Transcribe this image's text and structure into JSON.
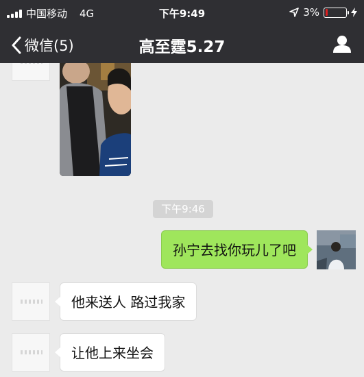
{
  "status_bar": {
    "carrier": "中国移动",
    "network": "4G",
    "time": "下午9:49",
    "battery_percent": "3%",
    "battery_level": 0.03,
    "icons": [
      "signal-icon",
      "location-arrow-icon",
      "battery-icon",
      "charging-icon"
    ]
  },
  "nav": {
    "back_label": "微信(5)",
    "title": "高至霆5.27",
    "icons": [
      "chevron-left-icon",
      "person-icon"
    ]
  },
  "messages": [
    {
      "type": "image",
      "from": "other"
    },
    {
      "type": "timestamp",
      "text": "下午9:46"
    },
    {
      "type": "text",
      "from": "me",
      "text": "孙宁去找你玩儿了吧"
    },
    {
      "type": "text",
      "from": "other",
      "text": "他来送人 路过我家"
    },
    {
      "type": "text",
      "from": "other",
      "text": "让他上来坐会"
    }
  ],
  "colors": {
    "bar": "#2f2f33",
    "background": "#ebebeb",
    "sent_bubble": "#9fe65c",
    "received_bubble": "#ffffff",
    "timestamp_chip": "#d4d4d4",
    "battery_low": "#e02020"
  }
}
